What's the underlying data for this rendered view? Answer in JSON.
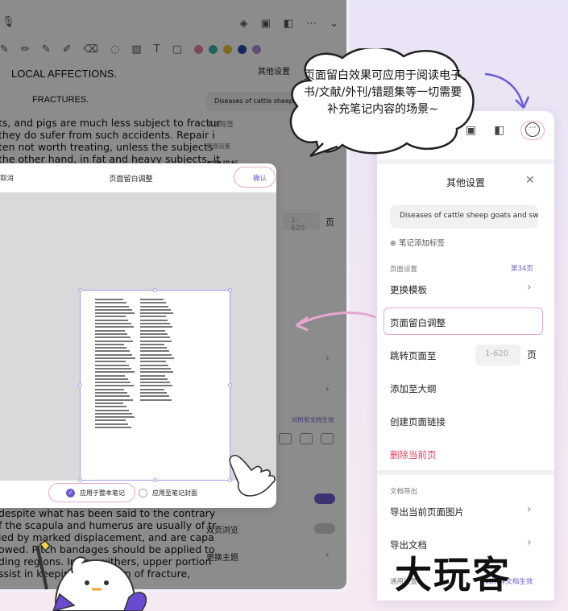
{
  "doc": {
    "title": "LOCAL AFFECTIONS.",
    "subtitle": "FRACTURES.",
    "lines_top": [
      "ts, and pigs are much less subject to fractur",
      "they do sufer from such accidents. Repair i",
      "ten not worth treating, unless the subjects",
      "the other hand, in fat and heavy subjects, it"
    ],
    "lines_bottom": [
      "despite what has been said to the contrary",
      "f the scapula and humerus are usually of tr",
      "ied by marked displacement, and are capa",
      "owed. Pitch bandages should be applied to",
      "ding regions. In the withers, upper portion",
      "ssist in keeping the region of fracture,"
    ]
  },
  "back_side": {
    "title": "其他设置",
    "doc_name": "Diseases of cattle sheep goats and swine",
    "add_tag": "添加标签",
    "section": "页面设置",
    "change_template": "更换模板",
    "range_placeholder": "1-620",
    "unit": "页",
    "apply_all": "对所有文档生效",
    "dual_page": "双页浏览",
    "change_theme": "更换主题"
  },
  "modal": {
    "cancel": "取消",
    "title": "页面留白调整",
    "confirm": "确认",
    "option_all_notes": "应用于整本笔记",
    "option_cover": "应用至笔记封面"
  },
  "panel": {
    "title": "其他设置",
    "doc_name": "Diseases of cattle sheep goats and swine",
    "add_tag": "笔记添加标签",
    "page_section": "页面设置",
    "page_number": "第34页",
    "items": [
      "更换模板",
      "页面留白调整",
      "跳转页面至",
      "添加至大纲",
      "创建页面链接",
      "删除当前页"
    ],
    "range_placeholder": "1-620",
    "unit": "页",
    "export_section": "文档导出",
    "export_items": [
      "导出当前页面图片",
      "导出文档"
    ],
    "general_section": "通用设置",
    "apply_all": "对所有文档生效"
  },
  "bubble": {
    "text": "页面留白效果可应用于阅读电子书/文献/外刊/错题集等一切需要补充笔记内容的场景~"
  },
  "brand": "大玩客",
  "colors": {
    "accent": "#6a5fd0",
    "highlight_ring": "#e6a8d0",
    "danger": "#e2405e",
    "pen_colors": [
      "#e77ea9",
      "#3fb7a8",
      "#e7c23b",
      "#2a4aa8",
      "#b38bd8"
    ]
  }
}
